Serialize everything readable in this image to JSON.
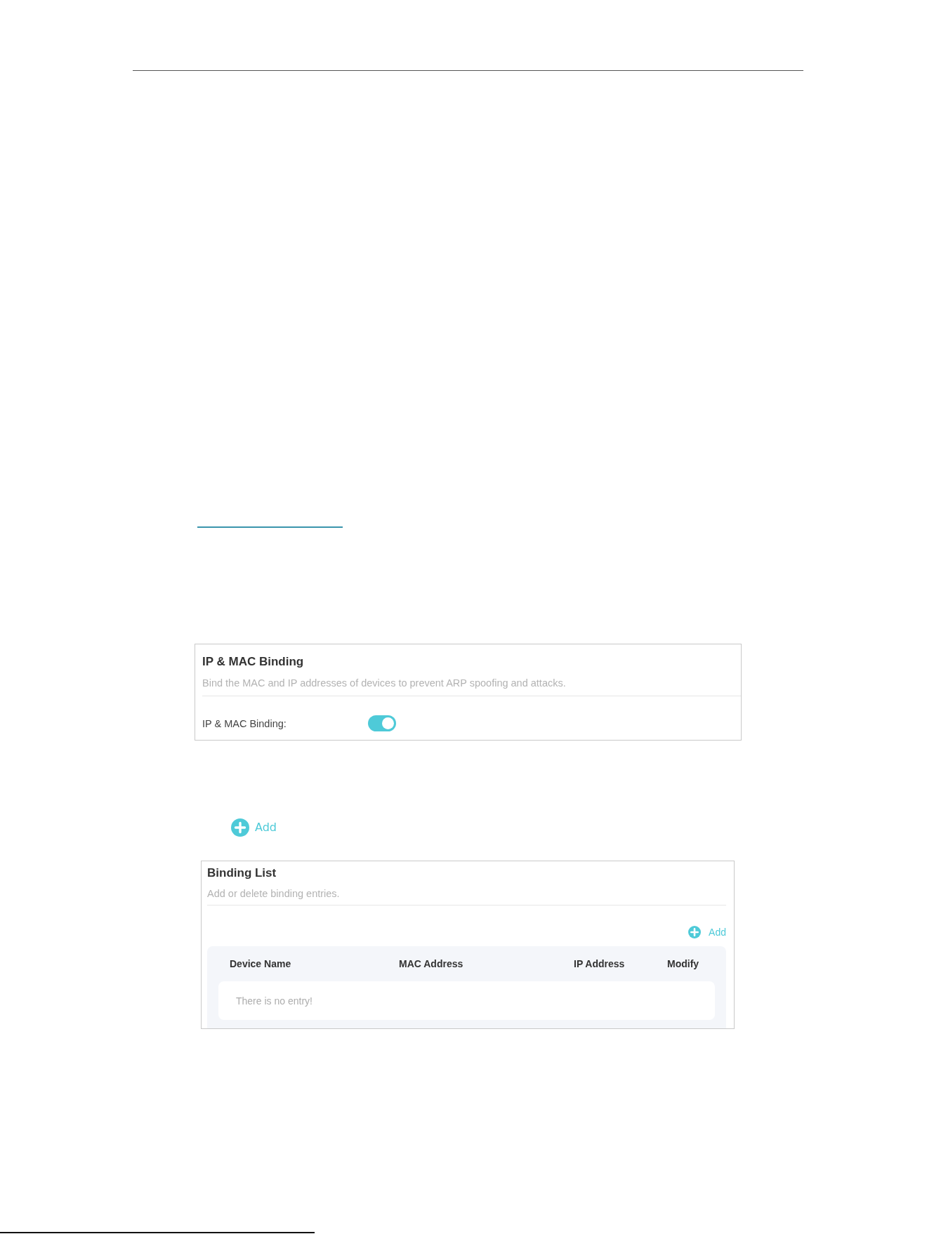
{
  "ip_mac_binding_panel": {
    "title": "IP & MAC Binding",
    "description": "Bind the MAC and IP addresses of devices to prevent ARP spoofing and attacks.",
    "setting": {
      "label": "IP & MAC Binding:",
      "on": true
    }
  },
  "add_button": {
    "label": "Add"
  },
  "binding_list_panel": {
    "title": "Binding List",
    "description": "Add or delete binding entries.",
    "add_button": {
      "label": "Add"
    },
    "table": {
      "columns": [
        "Device Name",
        "MAC Address",
        "IP Address",
        "Modify"
      ],
      "empty_message": "There is no entry!"
    }
  }
}
